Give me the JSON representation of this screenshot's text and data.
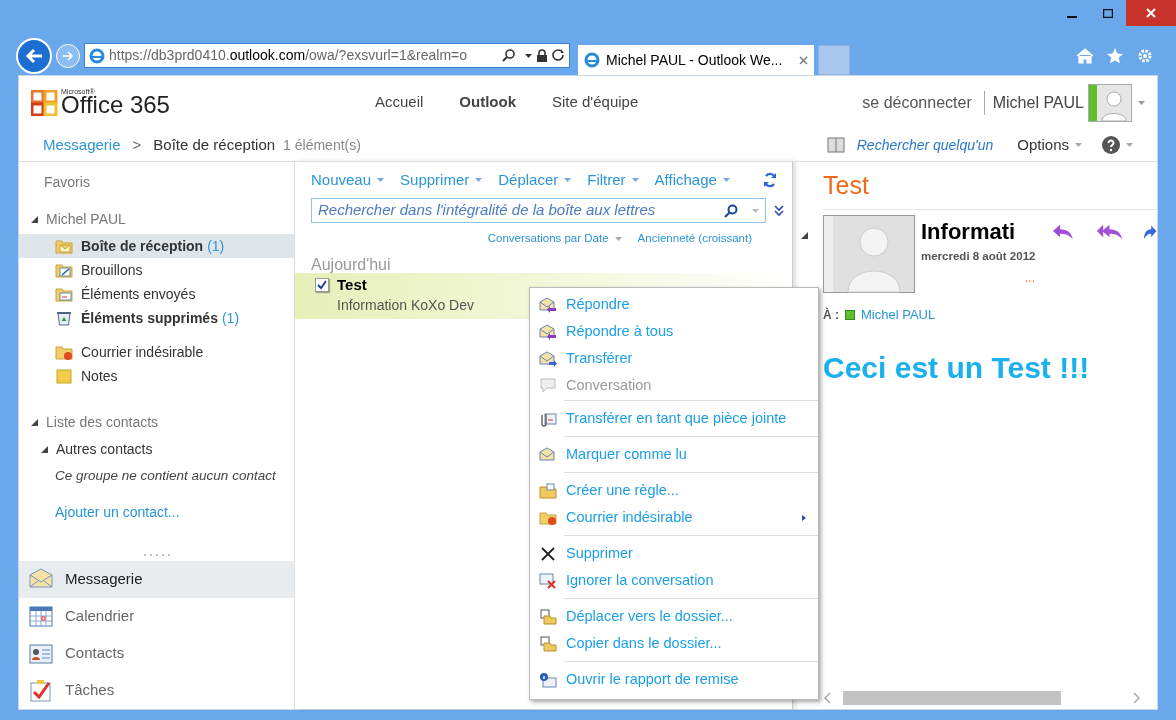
{
  "browser": {
    "url_prefix": "https://db3prd0410.",
    "url_domain": "outlook.com",
    "url_suffix": "/owa/?exsvurl=1&realm=o",
    "tab_title": "Michel PAUL - Outlook We..."
  },
  "header": {
    "logo_small": "Microsoft®",
    "logo": "Office 365",
    "nav": [
      {
        "label": "Accueil",
        "selected": false
      },
      {
        "label": "Outlook",
        "selected": true
      },
      {
        "label": "Site d'équipe",
        "selected": false
      }
    ],
    "sign_out": "se déconnecter",
    "user_name": "Michel PAUL"
  },
  "breadcrumb": {
    "root": "Messagerie",
    "separator": ">",
    "current": "Boîte de réception",
    "count": "1 élément(s)",
    "search_people": "Rechercher quelqu'un",
    "options": "Options"
  },
  "sidebar": {
    "favorites": "Favoris",
    "mailbox": {
      "label": "Michel PAUL",
      "expanded": true,
      "folder_groups": [
        [
          {
            "kind": "inbox",
            "label": "Boîte de réception",
            "count": "(1)",
            "bold": true,
            "selected": true
          },
          {
            "kind": "drafts",
            "label": "Brouillons",
            "bold": false,
            "selected": false
          },
          {
            "kind": "sent",
            "label": "Éléments envoyés",
            "bold": false,
            "selected": false
          },
          {
            "kind": "deleted",
            "label": "Éléments supprimés",
            "count": "(1)",
            "bold": true,
            "selected": false
          }
        ],
        [
          {
            "kind": "junk",
            "label": "Courrier indésirable",
            "bold": false,
            "selected": false
          },
          {
            "kind": "notes",
            "label": "Notes",
            "bold": false,
            "selected": false
          }
        ]
      ]
    },
    "contacts": {
      "label": "Liste des contacts",
      "expanded": true,
      "groups": [
        {
          "label": "Autres contacts",
          "expanded": true,
          "note": "Ce groupe ne contient aucun contact"
        }
      ],
      "add_link": "Ajouter un contact..."
    },
    "nav": [
      {
        "kind": "mail",
        "label": "Messagerie",
        "selected": true
      },
      {
        "kind": "calendar",
        "label": "Calendrier",
        "selected": false
      },
      {
        "kind": "contacts",
        "label": "Contacts",
        "selected": false
      },
      {
        "kind": "tasks",
        "label": "Tâches",
        "selected": false
      }
    ]
  },
  "toolbar": [
    "Nouveau",
    "Supprimer",
    "Déplacer",
    "Filtrer",
    "Affichage"
  ],
  "search": {
    "placeholder": "Rechercher dans l'intégralité de la boîte aux lettres"
  },
  "sort": [
    {
      "label": "Conversations par Date",
      "dropdown": true
    },
    {
      "label": "Ancienneté (croissant)",
      "dropdown": false
    }
  ],
  "message_list": {
    "group": "Aujourd'hui",
    "messages": [
      {
        "subject": "Test",
        "sender": "Information KoXo Dev",
        "checked": true,
        "selected": true
      }
    ]
  },
  "context_menu": [
    [
      {
        "kind": "reply",
        "label": "Répondre",
        "disabled": false
      },
      {
        "kind": "reply_all",
        "label": "Répondre à tous",
        "disabled": false
      },
      {
        "kind": "forward",
        "label": "Transférer",
        "disabled": false
      },
      {
        "kind": "conversation",
        "label": "Conversation",
        "disabled": true
      }
    ],
    [
      {
        "kind": "attach",
        "label": "Transférer en tant que pièce jointe",
        "disabled": false
      }
    ],
    [
      {
        "kind": "read",
        "label": "Marquer comme lu",
        "disabled": false
      }
    ],
    [
      {
        "kind": "rule",
        "label": "Créer une règle...",
        "disabled": false
      },
      {
        "kind": "junk",
        "label": "Courrier indésirable",
        "disabled": false,
        "submenu": true
      }
    ],
    [
      {
        "kind": "delete",
        "label": "Supprimer",
        "disabled": false
      },
      {
        "kind": "ignore",
        "label": "Ignorer la conversation",
        "disabled": false
      }
    ],
    [
      {
        "kind": "move",
        "label": "Déplacer vers le dossier...",
        "disabled": false
      },
      {
        "kind": "copy",
        "label": "Copier dans le dossier...",
        "disabled": false
      }
    ],
    [
      {
        "kind": "report",
        "label": "Ouvrir le rapport de remise",
        "disabled": false
      }
    ]
  ],
  "reading_pane": {
    "subject": "Test",
    "sender": "Informati",
    "date": "mercredi 8 août 2012",
    "more": "...",
    "to_label": "À :",
    "recipient": "Michel PAUL",
    "body": "Ceci est un Test !!!"
  }
}
